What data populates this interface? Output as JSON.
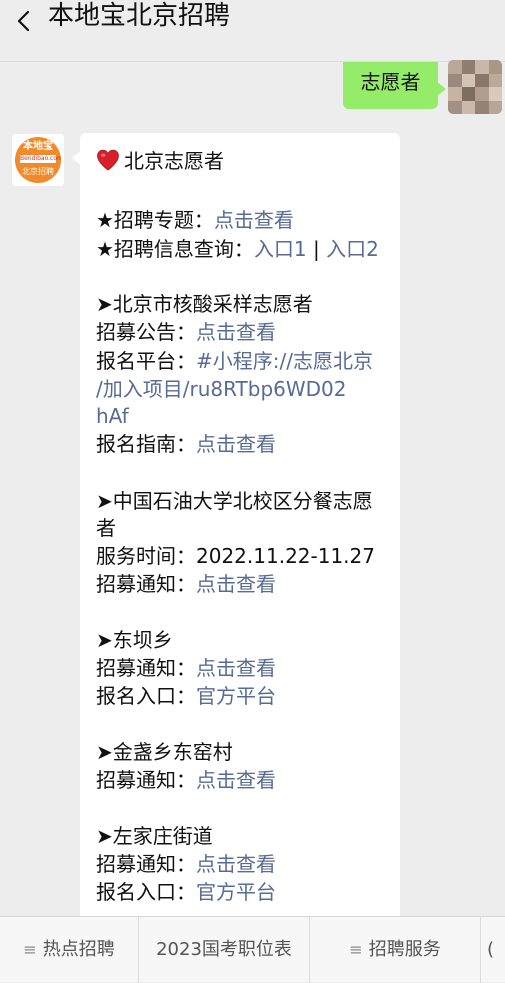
{
  "header": {
    "title": "本地宝北京招聘"
  },
  "user_message": {
    "text": "志愿者"
  },
  "bot": {
    "avatar_logo": {
      "top": "本地宝",
      "mid": "Bendibao.com",
      "bottom": "北京招聘"
    },
    "title": "北京志愿者",
    "lines": {
      "topic_label": "★招聘专题：",
      "topic_link": "点击查看",
      "info_label": "★招聘信息查询：",
      "info_link1": "入口1",
      "info_sep": " | ",
      "info_link2": "入口2",
      "s1_title": "➤北京市核酸采样志愿者",
      "s1_notice_label": "招募公告：",
      "s1_notice_link": "点击查看",
      "s1_platform_label": "报名平台：",
      "s1_platform_link_a": "#小程序://志愿北京",
      "s1_platform_link_b": "/加入项目/ru8RTbp6WD02",
      "s1_platform_link_c": "hAf",
      "s1_guide_label": "报名指南：",
      "s1_guide_link": "点击查看",
      "s2_title_a": "➤中国石油大学北校区分餐志愿",
      "s2_title_b": "者",
      "s2_time_label": "服务时间：",
      "s2_time_value": "2022.11.22-11.27",
      "s2_notice_label": "招募通知：",
      "s2_notice_link": "点击查看",
      "s3_title": "➤东坝乡",
      "s3_notice_label": "招募通知：",
      "s3_notice_link": "点击查看",
      "s3_entry_label": "报名入口：",
      "s3_entry_link": "官方平台",
      "s4_title": "➤金盏乡东窑村",
      "s4_notice_label": "招募通知：",
      "s4_notice_link": "点击查看",
      "s5_title": "➤左家庄街道",
      "s5_notice_label": "招募通知：",
      "s5_notice_link": "点击查看",
      "s5_entry_label": "报名入口：",
      "s5_entry_link": "官方平台"
    }
  },
  "menu": {
    "items": [
      "热点招聘",
      "2023国考职位表",
      "招聘服务",
      "("
    ]
  },
  "colors": {
    "link": "#576b95",
    "user_bubble": "#95ec69",
    "background": "#ededed",
    "brand_orange": "#f08a2a"
  },
  "icons": [
    "back-chevron-icon",
    "heart-icon",
    "menu-lines-icon"
  ]
}
